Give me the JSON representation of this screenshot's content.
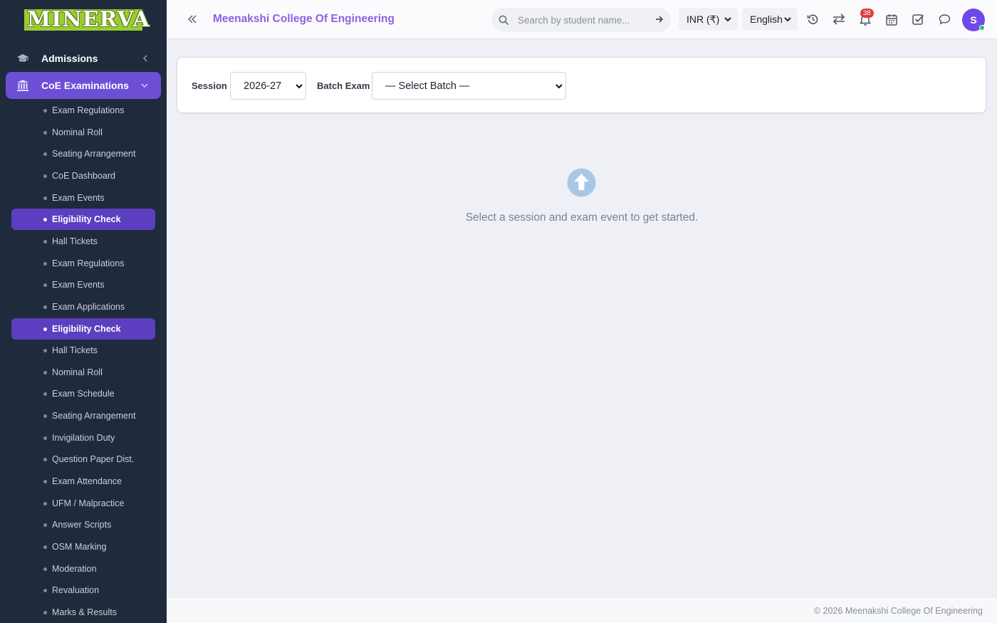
{
  "brand": {
    "logo_text": "MINERVA"
  },
  "sidebar": {
    "top_items": [
      {
        "label": "Admissions",
        "icon": "graduation-cap-icon",
        "expanded": false
      },
      {
        "label": "CoE Examinations",
        "icon": "institution-icon",
        "expanded": true
      }
    ],
    "sub_items": [
      {
        "label": "Exam Regulations",
        "active": false
      },
      {
        "label": "Nominal Roll",
        "active": false
      },
      {
        "label": "Seating Arrangement",
        "active": false
      },
      {
        "label": "CoE Dashboard",
        "active": false
      },
      {
        "label": "Exam Events",
        "active": false
      },
      {
        "label": "Eligibility Check",
        "active": true
      },
      {
        "label": "Hall Tickets",
        "active": false
      },
      {
        "label": "Exam Regulations",
        "active": false
      },
      {
        "label": "Exam Events",
        "active": false
      },
      {
        "label": "Exam Applications",
        "active": false
      },
      {
        "label": "Eligibility Check",
        "active": true
      },
      {
        "label": "Hall Tickets",
        "active": false
      },
      {
        "label": "Nominal Roll",
        "active": false
      },
      {
        "label": "Exam Schedule",
        "active": false
      },
      {
        "label": "Seating Arrangement",
        "active": false
      },
      {
        "label": "Invigilation Duty",
        "active": false
      },
      {
        "label": "Question Paper Dist.",
        "active": false
      },
      {
        "label": "Exam Attendance",
        "active": false
      },
      {
        "label": "UFM / Malpractice",
        "active": false
      },
      {
        "label": "Answer Scripts",
        "active": false
      },
      {
        "label": "OSM Marking",
        "active": false
      },
      {
        "label": "Moderation",
        "active": false
      },
      {
        "label": "Revaluation",
        "active": false
      },
      {
        "label": "Marks & Results",
        "active": false
      }
    ]
  },
  "header": {
    "college_name": "Meenakshi College Of Engineering",
    "search_placeholder": "Search by student name...",
    "currency": "INR (₹)",
    "language": "English",
    "notification_count": "38",
    "avatar_initial": "S"
  },
  "filters": {
    "session_label": "Session",
    "session_value": "2026-27",
    "batch_label": "Batch Exam",
    "batch_value": "— Select Batch —"
  },
  "empty_state": {
    "icon": "arrow-circle-up-icon",
    "message": "Select a session and exam event to get started."
  },
  "footer": {
    "text": "© 2026 Meenakshi College Of Engineering"
  },
  "colors": {
    "sidebar_bg": "#1f2a3c",
    "accent": "#6d4fd6",
    "active_item": "#5b3fc0",
    "college_title": "#8a63e0",
    "badge": "#e23b3b"
  }
}
